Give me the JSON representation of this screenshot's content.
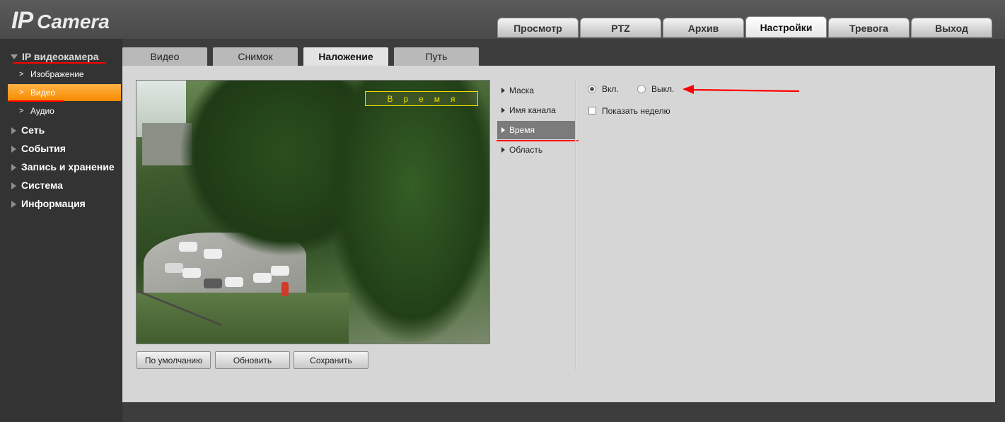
{
  "header": {
    "logo_ip": "IP",
    "logo_camera": "Camera"
  },
  "main_tabs": [
    {
      "label": "Просмотр",
      "active": false
    },
    {
      "label": "PTZ",
      "active": false
    },
    {
      "label": "Архив",
      "active": false
    },
    {
      "label": "Настройки",
      "active": true
    },
    {
      "label": "Тревога",
      "active": false
    },
    {
      "label": "Выход",
      "active": false
    }
  ],
  "sidebar": {
    "group_title": "IP видеокамера",
    "sub_items": [
      "Изображение",
      "Видео",
      "Аудио"
    ],
    "active_sub": "Видео",
    "items": [
      "Сеть",
      "События",
      "Запись и хранение",
      "Система",
      "Информация"
    ]
  },
  "sub_tabs": [
    {
      "label": "Видео",
      "active": false
    },
    {
      "label": "Снимок",
      "active": false
    },
    {
      "label": "Наложение",
      "active": true
    },
    {
      "label": "Путь",
      "active": false
    }
  ],
  "preview": {
    "overlay_text": "Время"
  },
  "buttons": {
    "default": "По умолчанию",
    "refresh": "Обновить",
    "save": "Сохранить"
  },
  "overlay_menu": {
    "items": [
      "Маска",
      "Имя канала",
      "Время",
      "Область"
    ],
    "active": "Время"
  },
  "settings": {
    "on_label": "Вкл.",
    "off_label": "Выкл.",
    "selected": "Вкл.",
    "show_week_label": "Показать неделю",
    "show_week_checked": false
  },
  "colors": {
    "accent_orange": "#f58a00",
    "annotation_red": "#ff0000"
  }
}
